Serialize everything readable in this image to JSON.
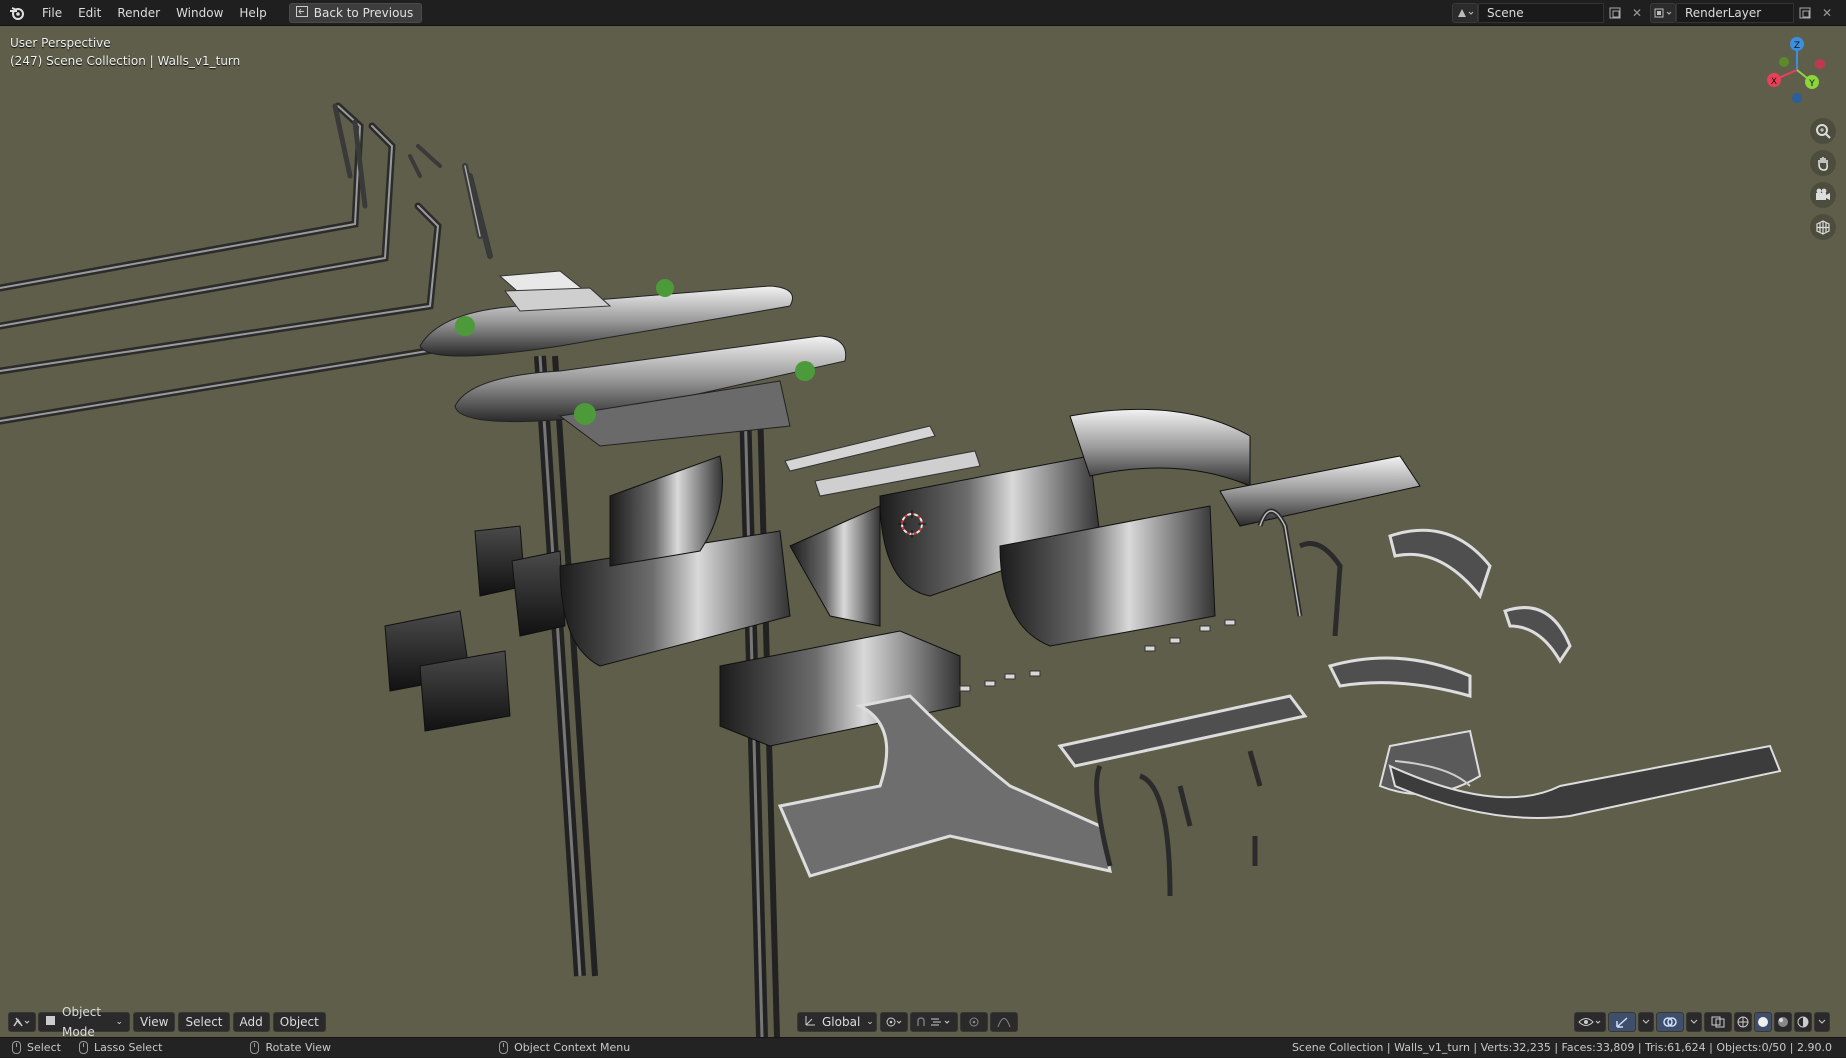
{
  "menu": {
    "file": "File",
    "edit": "Edit",
    "render": "Render",
    "window": "Window",
    "help": "Help"
  },
  "back_button": "Back to Previous",
  "scene": {
    "name": "Scene"
  },
  "render_layer": {
    "name": "RenderLayer"
  },
  "viewport": {
    "view_name": "User Perspective",
    "collection_info": "(247) Scene Collection | Walls_v1_turn"
  },
  "gizmo": {
    "x": "X",
    "y": "Y",
    "z": "Z"
  },
  "header": {
    "mode": "Object Mode",
    "view": "View",
    "select": "Select",
    "add": "Add",
    "object": "Object",
    "orientation": "Global"
  },
  "status": {
    "select": "Select",
    "lasso": "Lasso Select",
    "rotate": "Rotate View",
    "context": "Object Context Menu",
    "stats": "Scene Collection | Walls_v1_turn | Verts:32,235 | Faces:33,809 | Tris:61,624 | Objects:0/50 | 2.90.0"
  },
  "colors": {
    "viewport_bg": "#5f5e4b",
    "axis_x": "#e8405a",
    "axis_y": "#8bd63c",
    "axis_z": "#3a8fe0"
  }
}
